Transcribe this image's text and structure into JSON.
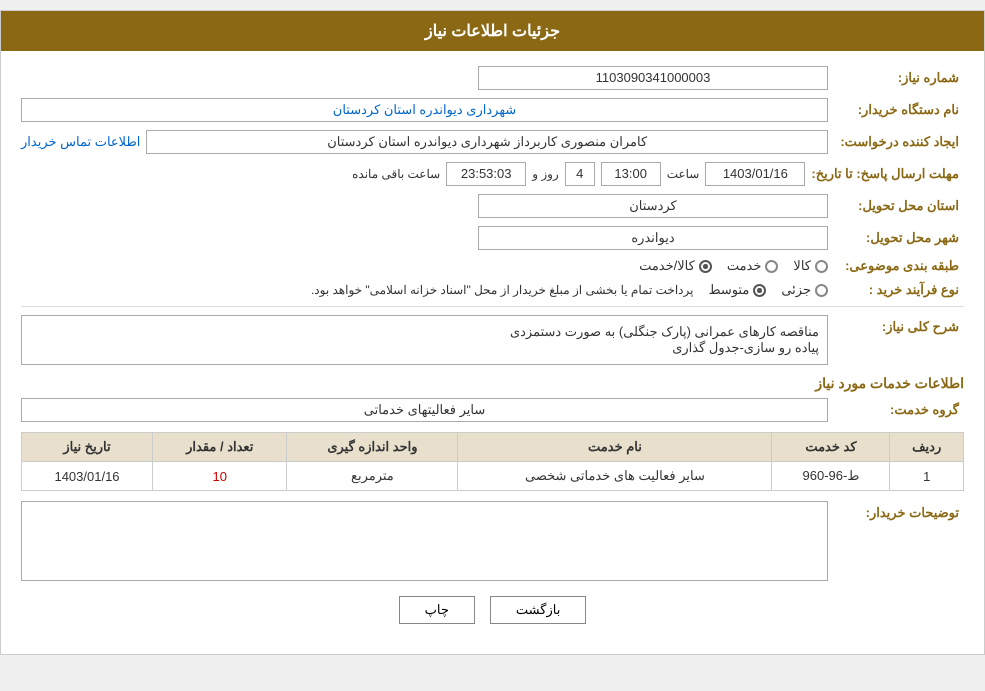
{
  "header": {
    "title": "جزئیات اطلاعات نیاز"
  },
  "fields": {
    "shomareNiaz_label": "شماره نیاز:",
    "shomareNiaz_value": "1103090341000003",
    "namDastgah_label": "نام دستگاه خریدار:",
    "namDastgah_value": "شهرداری دیواندره استان کردستان",
    "ejadKonande_label": "ایجاد کننده درخواست:",
    "ejadKonande_value": "کامران منصوری کاربرداز شهرداری دیواندره استان کردستان",
    "ejadKonande_link": "اطلاعات تماس خریدار",
    "mohlat_label": "مهلت ارسال پاسخ: تا تاریخ:",
    "date_value": "1403/01/16",
    "saatLabel": "ساعت",
    "saat_value": "13:00",
    "roz_label": "روز و",
    "roz_value": "4",
    "baghimande_label": "ساعت باقی مانده",
    "baghimande_value": "23:53:03",
    "ostan_label": "استان محل تحویل:",
    "ostan_value": "کردستان",
    "shahr_label": "شهر محل تحویل:",
    "shahr_value": "دیواندره",
    "tabaghe_label": "طبقه بندی موضوعی:",
    "tabaghe_kala": "کالا",
    "tabaghe_khadamat": "خدمت",
    "tabaghe_kala_khadamat": "کالا/خدمت",
    "tabaghe_selected": "kala_khadamat",
    "noeFarayand_label": "نوع فرآیند خرید :",
    "jozii": "جزئی",
    "mottavaset": "متوسط",
    "note": "پرداخت تمام یا بخشی از مبلغ خریدار از محل \"اسناد خزانه اسلامی\" خواهد بود.",
    "noeFarayand_selected": "mottavaset",
    "sharh_label": "شرح کلی نیاز:",
    "sharh_value": "مناقصه کارهای عمرانی (پارک جنگلی) به صورت دستمزدی\nپیاده رو سازی-جدول گذاری",
    "khadamat_label": "اطلاعات خدمات مورد نیاز",
    "grohe_khadamat_label": "گروه خدمت:",
    "grohe_khadamat_value": "سایر فعالیتهای خدماتی",
    "table": {
      "headers": [
        "ردیف",
        "کد خدمت",
        "نام خدمت",
        "واحد اندازه گیری",
        "تعداد / مقدار",
        "تاریخ نیاز"
      ],
      "rows": [
        {
          "radif": "1",
          "kod": "ط-96-960",
          "nam": "سایر فعالیت های خدماتی شخصی",
          "vahed": "مترمربع",
          "tedad": "10",
          "tarikh": "1403/01/16"
        }
      ]
    },
    "tosihiat_label": "توضیحات خریدار:",
    "tosihiat_value": ""
  },
  "buttons": {
    "print": "چاپ",
    "back": "بازگشت"
  }
}
